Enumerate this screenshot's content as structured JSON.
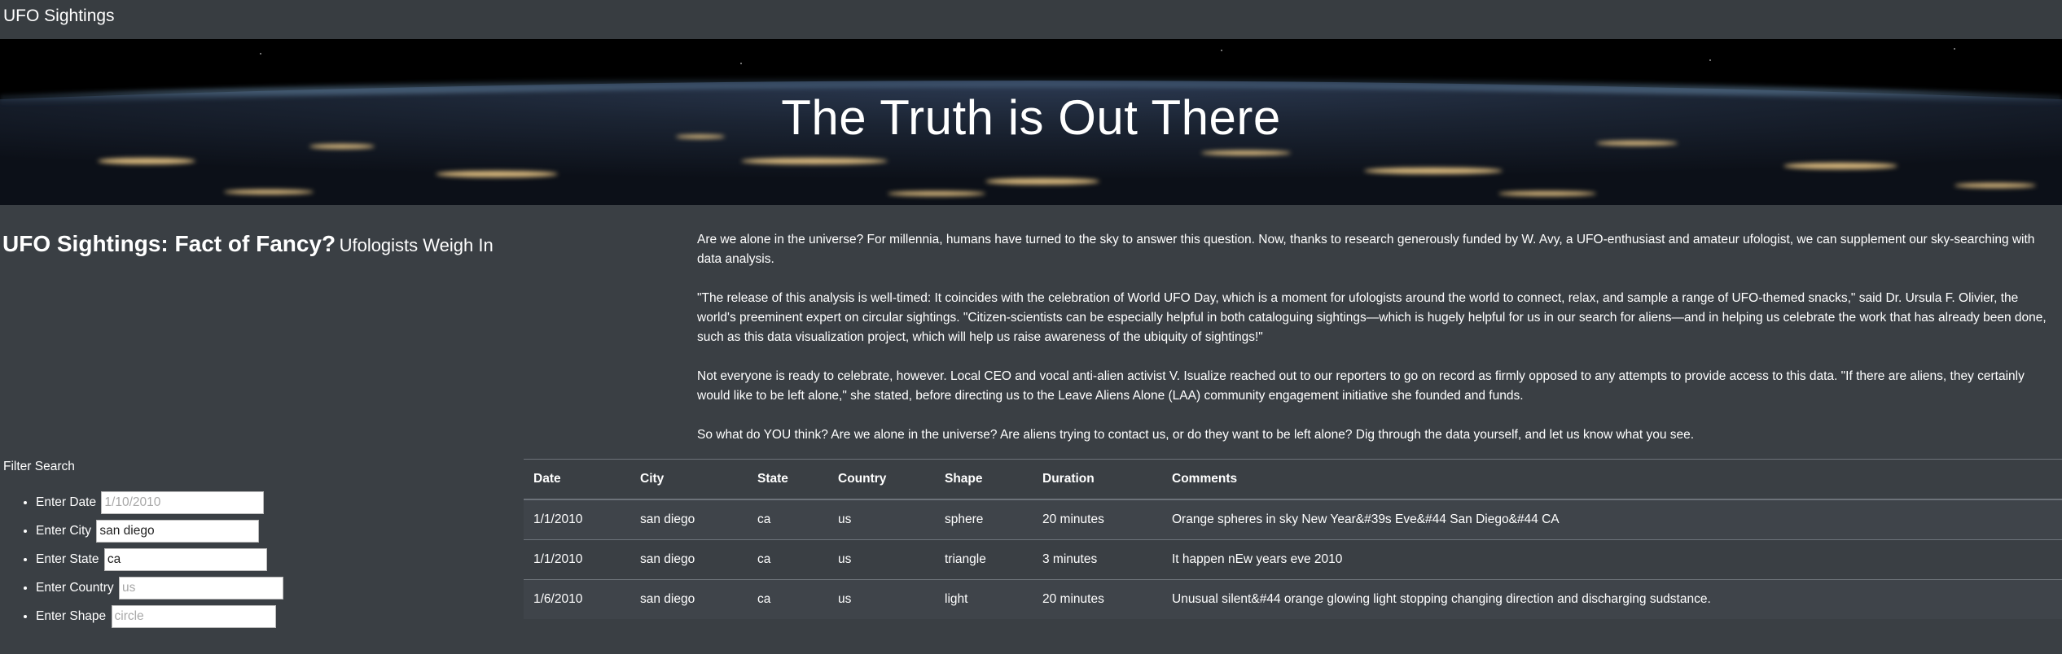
{
  "nav": {
    "brand": "UFO Sightings"
  },
  "hero": {
    "title": "The Truth is Out There"
  },
  "heading": {
    "main": "UFO Sightings: Fact of Fancy?",
    "sub": "Ufologists Weigh In"
  },
  "article": {
    "paragraphs": [
      "Are we alone in the universe? For millennia, humans have turned to the sky to answer this question. Now, thanks to research generously funded by W. Avy, a UFO-enthusiast and amateur ufologist, we can supplement our sky-searching with data analysis.",
      "\"The release of this analysis is well-timed: It coincides with the celebration of World UFO Day, which is a moment for ufologists around the world to connect, relax, and sample a range of UFO-themed snacks,\" said Dr. Ursula F. Olivier, the world's preeminent expert on circular sightings. \"Citizen-scientists can be especially helpful in both cataloguing sightings—which is hugely helpful for us in our search for aliens—and in helping us celebrate the work that has already been done, such as this data visualization project, which will help us raise awareness of the ubiquity of sightings!\"",
      "Not everyone is ready to celebrate, however. Local CEO and vocal anti-alien activist V. Isualize reached out to our reporters to go on record as firmly opposed to any attempts to provide access to this data. \"If there are aliens, they certainly would like to be left alone,\" she stated, before directing us to the Leave Aliens Alone (LAA) community engagement initiative she founded and funds.",
      "So what do YOU think? Are we alone in the universe? Are aliens trying to contact us, or do they want to be left alone? Dig through the data yourself, and let us know what you see."
    ]
  },
  "filters": {
    "title": "Filter Search",
    "items": [
      {
        "label": "Enter Date",
        "value": "",
        "placeholder": "1/10/2010"
      },
      {
        "label": "Enter City",
        "value": "san diego",
        "placeholder": ""
      },
      {
        "label": "Enter State",
        "value": "ca",
        "placeholder": ""
      },
      {
        "label": "Enter Country",
        "value": "",
        "placeholder": "us"
      },
      {
        "label": "Enter Shape",
        "value": "",
        "placeholder": "circle"
      }
    ]
  },
  "table": {
    "columns": [
      "Date",
      "City",
      "State",
      "Country",
      "Shape",
      "Duration",
      "Comments"
    ],
    "rows": [
      [
        "1/1/2010",
        "san diego",
        "ca",
        "us",
        "sphere",
        "20 minutes",
        "Orange spheres in sky New Year&#39s Eve&#44 San Diego&#44 CA"
      ],
      [
        "1/1/2010",
        "san diego",
        "ca",
        "us",
        "triangle",
        "3 minutes",
        "It happen nEw years eve 2010"
      ],
      [
        "1/6/2010",
        "san diego",
        "ca",
        "us",
        "light",
        "20 minutes",
        "Unusual silent&#44 orange glowing light stopping changing direction and discharging sudstance."
      ]
    ]
  },
  "colors": {
    "background": "#3a3f44",
    "navbar": "#383d41",
    "hero_space": "#000000",
    "text": "#ffffff",
    "rule": "#6c7279"
  }
}
